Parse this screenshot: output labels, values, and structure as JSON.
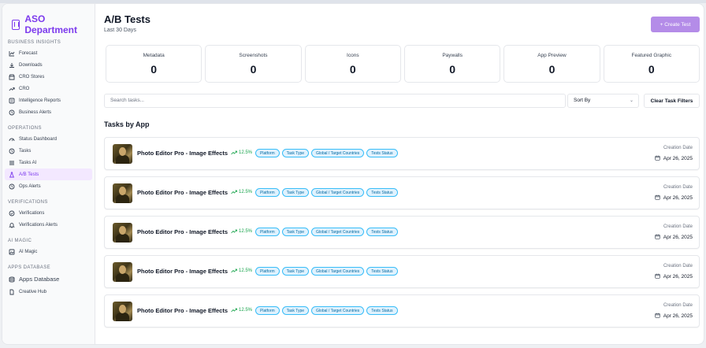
{
  "sidebar": {
    "brand": "ASO Department",
    "sections": [
      {
        "title": "BUSINESS INSIGHTS",
        "items": [
          {
            "label": "Forecast",
            "icon": "chart-line-icon"
          },
          {
            "label": "Downloads",
            "icon": "download-icon"
          },
          {
            "label": "CRO Stores",
            "icon": "store-icon"
          },
          {
            "label": "CRO",
            "icon": "trending-up-icon"
          },
          {
            "label": "Intelligence Reports",
            "icon": "report-icon"
          },
          {
            "label": "Business Alerts",
            "icon": "clock-icon"
          }
        ]
      },
      {
        "title": "OPERATIONS",
        "items": [
          {
            "label": "Status Dashboard",
            "icon": "gauge-icon"
          },
          {
            "label": "Tasks",
            "icon": "clock-icon"
          },
          {
            "label": "Tasks AI",
            "icon": "list-icon"
          },
          {
            "label": "A/B Tests",
            "icon": "flask-icon",
            "active": true
          },
          {
            "label": "Ops Alerts",
            "icon": "clock-icon"
          }
        ]
      },
      {
        "title": "VERIFICATIONS",
        "items": [
          {
            "label": "Verifications",
            "icon": "check-circle-icon"
          },
          {
            "label": "Verifications Alerts",
            "icon": "bell-icon"
          }
        ]
      },
      {
        "title": "AI MAGIC",
        "items": [
          {
            "label": "AI Magic",
            "icon": "image-icon"
          }
        ]
      },
      {
        "title": "APPS DATABASE",
        "items": [
          {
            "label": "Apps Database",
            "icon": "database-icon",
            "big": true
          },
          {
            "label": "Creative Hub",
            "icon": "file-icon"
          }
        ]
      }
    ]
  },
  "header": {
    "title": "A/B Tests",
    "subtitle": "Last 30 Days",
    "create_label": "+ Create Test"
  },
  "metrics": [
    {
      "label": "Metadata",
      "value": "0"
    },
    {
      "label": "Screenshots",
      "value": "0"
    },
    {
      "label": "Icons",
      "value": "0"
    },
    {
      "label": "Paywalls",
      "value": "0"
    },
    {
      "label": "App Preview",
      "value": "0"
    },
    {
      "label": "Featured Graphic",
      "value": "0"
    }
  ],
  "filters": {
    "search_placeholder": "Search tasks...",
    "sort_label": "Sort By",
    "clear_label": "Clear Task Filters"
  },
  "tasks_heading": "Tasks by App",
  "tasks": [
    {
      "app_name": "Photo Editor Pro - Image Effects",
      "growth": "12.5%",
      "tags": [
        "Platform",
        "Task Type",
        "Global / Target Countries",
        "Tests Status"
      ],
      "creation_label": "Creation Date",
      "creation_date": "Apr 26, 2025"
    },
    {
      "app_name": "Photo Editor Pro - Image Effects",
      "growth": "12.5%",
      "tags": [
        "Platform",
        "Task Type",
        "Global / Target Countries",
        "Tests Status"
      ],
      "creation_label": "Creation Date",
      "creation_date": "Apr 26, 2025"
    },
    {
      "app_name": "Photo Editor Pro - Image Effects",
      "growth": "12.5%",
      "tags": [
        "Platform",
        "Task Type",
        "Global / Target Countries",
        "Tests Status"
      ],
      "creation_label": "Creation Date",
      "creation_date": "Apr 26, 2025"
    },
    {
      "app_name": "Photo Editor Pro - Image Effects",
      "growth": "12.5%",
      "tags": [
        "Platform",
        "Task Type",
        "Global / Target Countries",
        "Tests Status"
      ],
      "creation_label": "Creation Date",
      "creation_date": "Apr 26, 2025"
    },
    {
      "app_name": "Photo Editor Pro - Image Effects",
      "growth": "12.5%",
      "tags": [
        "Platform",
        "Task Type",
        "Global / Target Countries",
        "Tests Status"
      ],
      "creation_label": "Creation Date",
      "creation_date": "Apr 26, 2025"
    }
  ],
  "colors": {
    "accent": "#7c3aed",
    "accent_button": "#b48ce8",
    "active_bg": "#f3e8ff",
    "growth": "#16a34a",
    "tag_border": "#38bdf8"
  }
}
